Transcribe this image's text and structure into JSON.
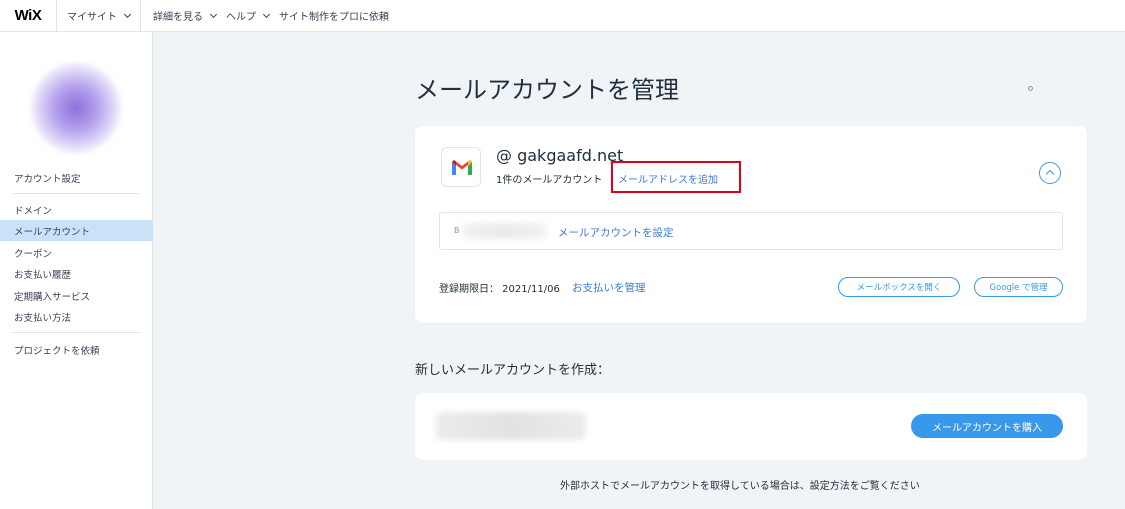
{
  "topbar": {
    "logo": "WiX",
    "my_sites": "マイサイト",
    "details": "詳細を見る",
    "help": "ヘルプ",
    "hire_pro": "サイト制作をプロに依頼"
  },
  "sidebar": {
    "items": [
      {
        "label": "アカウント設定"
      },
      {
        "label": "ドメイン"
      },
      {
        "label": "メールアカウント"
      },
      {
        "label": "クーポン"
      },
      {
        "label": "お支払い履歴"
      },
      {
        "label": "定期購入サービス"
      },
      {
        "label": "お支払い方法"
      },
      {
        "label": "プロジェクトを依頼"
      }
    ],
    "active_index": 2
  },
  "main": {
    "title": "メールアカウントを管理",
    "card": {
      "domain": "@ gakgaafd.net",
      "account_count": "1件のメールアカウント",
      "add_address_link": "メールアドレスを追加",
      "account_row": {
        "initial": "B",
        "setup_link": "メールアカウントを設定"
      },
      "expiry": "登録期限日： 2021/11/06",
      "manage_payment_link": "お支払いを管理",
      "open_mailbox_button": "メールボックスを開く",
      "google_manage_button": "Google で管理"
    },
    "new_account": {
      "title": "新しいメールアカウントを作成：",
      "buy_button": "メールアカウントを購入"
    },
    "footer_note": "外部ホストでメールアカウントを取得している場合は、設定方法をご覧ください"
  },
  "colors": {
    "accent": "#3899ec",
    "link": "#3b7bd6",
    "highlight_box": "#e0001a",
    "sidebar_active": "#c9e2f7",
    "background": "#f0f4f7"
  }
}
